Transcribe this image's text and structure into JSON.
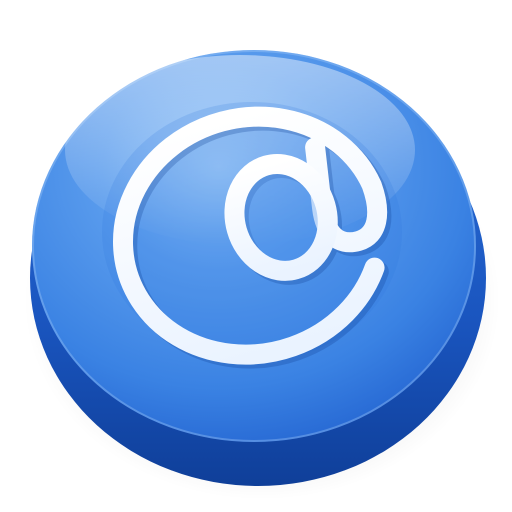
{
  "icon": {
    "name": "email-at-icon",
    "glyph": "@",
    "colors": {
      "face_light": "#7fb6f4",
      "face_mid": "#3f87e6",
      "face_dark": "#1c5fcf",
      "rim_dark": "#0f3f99",
      "glyph": "#ffffff",
      "background": "#ffffff"
    }
  }
}
